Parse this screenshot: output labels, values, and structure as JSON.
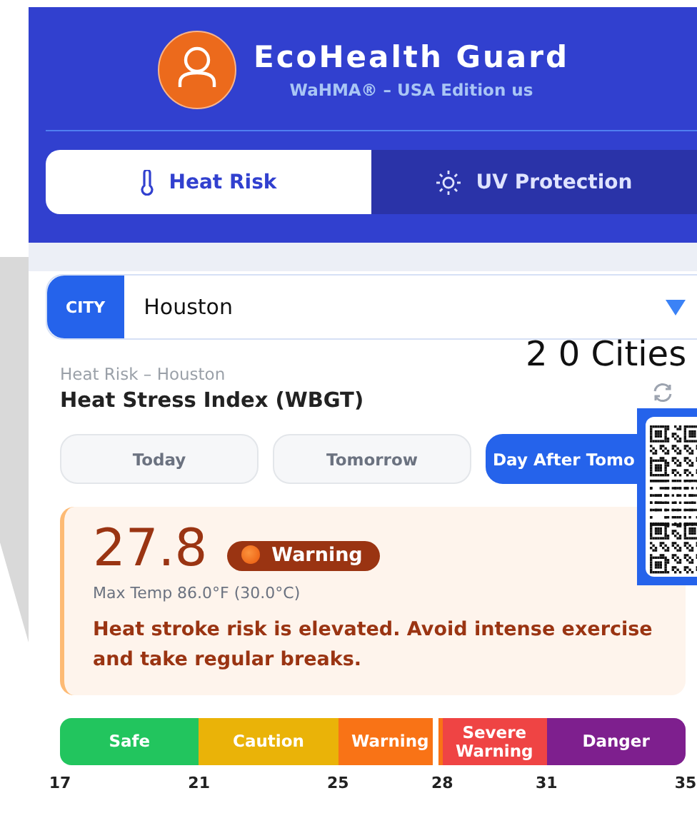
{
  "header": {
    "title": "EcoHealth Guard",
    "subtitle": "WaHMA® – USA Edition us"
  },
  "tabs": [
    {
      "label": "Heat Risk",
      "selected": true
    },
    {
      "label": "UV Protection",
      "selected": false
    }
  ],
  "city_select": {
    "label": "CITY",
    "value": "Houston"
  },
  "overlay": {
    "cities_text": "2 0 Cities"
  },
  "section": {
    "caption": "Heat Risk – Houston",
    "title": "Heat Stress Index (WBGT)"
  },
  "days": [
    {
      "label": "Today",
      "selected": false
    },
    {
      "label": "Tomorrow",
      "selected": false
    },
    {
      "label": "Day After Tomo",
      "selected": true
    }
  ],
  "reading": {
    "value": "27.8",
    "badge": "Warning",
    "max_temp": "Max Temp 86.0°F (30.0°C)",
    "advice": "Heat stroke risk is elevated. Avoid intense exercise and take regular breaks."
  },
  "scale": {
    "segments": [
      {
        "label": "Safe",
        "color": "#22c55e"
      },
      {
        "label": "Caution",
        "color": "#eab308"
      },
      {
        "label": "Warning",
        "color": "#f97316"
      },
      {
        "label": "Severe Warning",
        "color": "#ef4444"
      },
      {
        "label": "Danger",
        "color": "#7e1f8e"
      }
    ],
    "ticks": [
      "17",
      "21",
      "25",
      "28",
      "31",
      "35"
    ]
  }
}
